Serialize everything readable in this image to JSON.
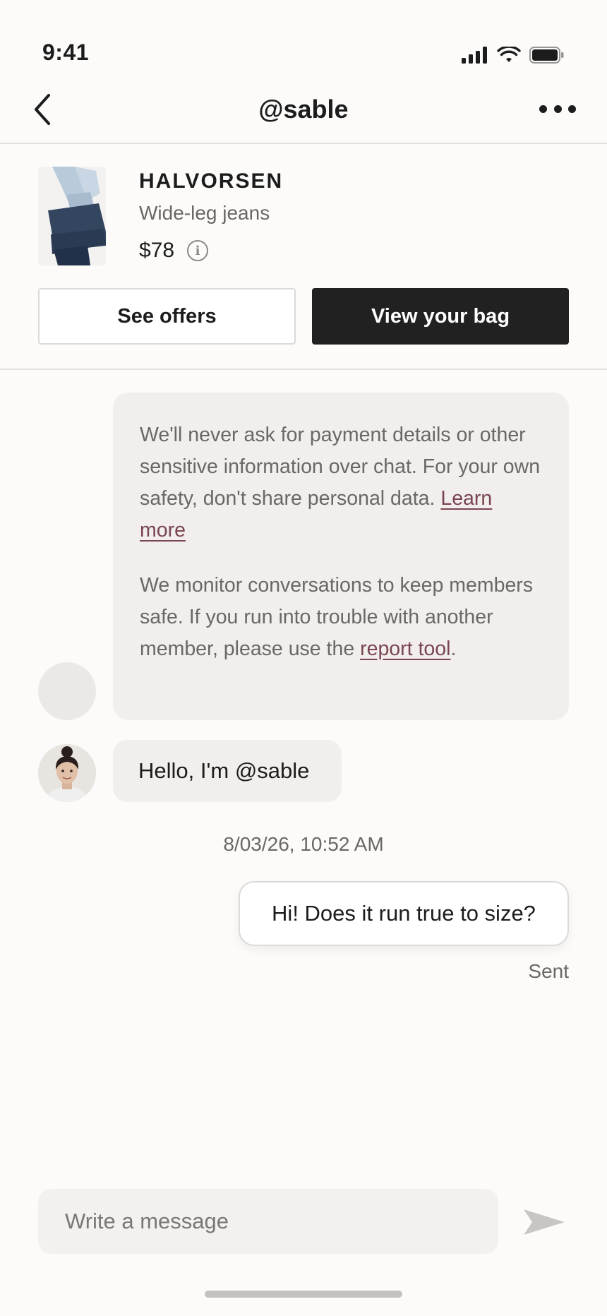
{
  "status_bar": {
    "time": "9:41",
    "icons": [
      "signal-icon",
      "wifi-icon",
      "battery-icon"
    ]
  },
  "nav": {
    "title": "@sable",
    "back_icon": "chevron-left-icon",
    "more_icon": "more-dots-icon"
  },
  "product": {
    "brand": "HALVORSEN",
    "name": "Wide-leg jeans",
    "price": "$78",
    "info_icon": "info-icon",
    "see_offers_label": "See offers",
    "view_bag_label": "View your bag"
  },
  "chat": {
    "notice": {
      "paragraph1_text": "We'll never ask for payment details or other sensitive information over chat. For your own safety, don't share personal data. ",
      "paragraph1_link": "Learn more",
      "paragraph2_text": "We monitor conversations to keep members safe. If you run into trouble with another member, please use the ",
      "paragraph2_link": "report tool",
      "paragraph2_end": "."
    },
    "incoming_message": "Hello, I'm @sable",
    "timestamp": "8/03/26, 10:52 AM",
    "outgoing_message": "Hi! Does it run true to size?",
    "outgoing_status": "Sent"
  },
  "composer": {
    "placeholder": "Write a message",
    "send_icon": "send-icon"
  },
  "colors": {
    "background": "#fcfbfa",
    "dark_button": "#222121",
    "bubble": "#f1eeec",
    "link": "#7a4552",
    "muted_text": "#6a6866"
  }
}
